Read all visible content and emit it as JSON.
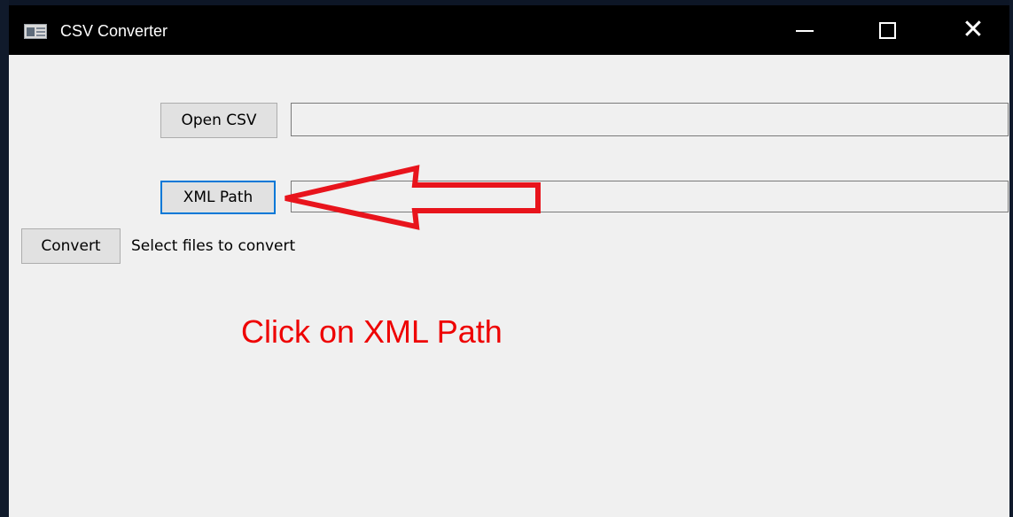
{
  "window": {
    "title": "CSV Converter",
    "controls": {
      "minimize": "—",
      "maximize": "□",
      "close": "✕"
    }
  },
  "form": {
    "open_csv_label": "Open CSV",
    "csv_path_value": "",
    "xml_path_label": "XML Path",
    "xml_path_value": "",
    "convert_label": "Convert",
    "status": "Select files to convert"
  },
  "annotation": {
    "text": "Click on XML Path",
    "color": "#ee0000",
    "arrow_color": "#e8141c"
  },
  "colors": {
    "titlebar": "#000000",
    "window_bg": "#f0f0f0",
    "focus_border": "#0078d7"
  }
}
